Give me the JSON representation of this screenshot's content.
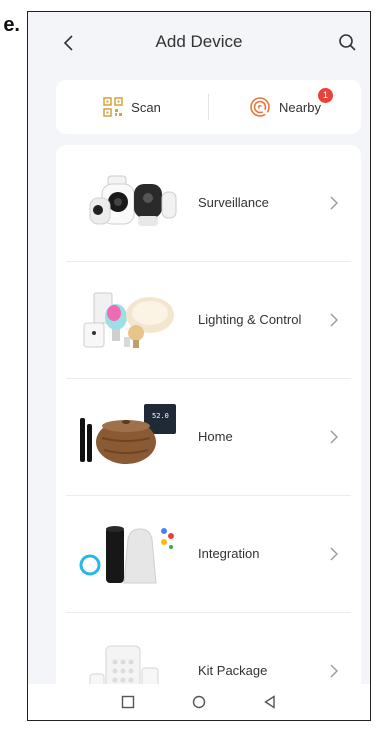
{
  "edge_letter": "e.",
  "header": {
    "title": "Add Device"
  },
  "quick_actions": {
    "scan_label": "Scan",
    "nearby_label": "Nearby",
    "nearby_badge": "1"
  },
  "categories": [
    {
      "label": "Surveillance"
    },
    {
      "label": "Lighting & Control"
    },
    {
      "label": "Home"
    },
    {
      "label": "Integration"
    },
    {
      "label": "Kit Package"
    }
  ],
  "colors": {
    "badge": "#e8433a",
    "scan_icon": "#d9a23c",
    "nearby_icon": "#e8783a"
  },
  "icons": {
    "back": "chevron-left-icon",
    "search": "search-icon",
    "scan": "qr-scan-icon",
    "nearby": "radar-icon",
    "row_chevron": "chevron-right-icon",
    "nav": [
      "square-icon",
      "circle-icon",
      "triangle-back-icon"
    ]
  }
}
